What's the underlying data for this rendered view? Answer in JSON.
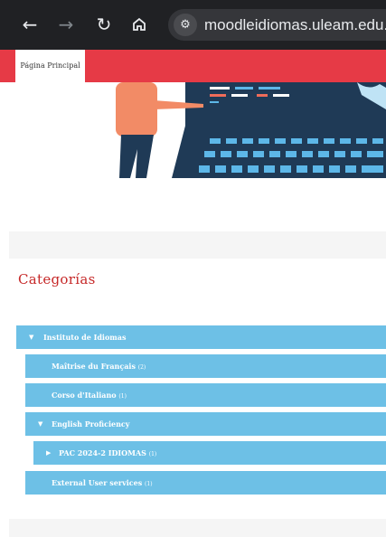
{
  "browser": {
    "back_icon": "arrow-left-icon",
    "forward_icon": "arrow-right-icon",
    "reload_icon": "reload-icon",
    "home_icon": "home-icon",
    "site_info_icon": "tune-icon",
    "url": "moodleidiomas.uleam.edu.ec"
  },
  "navbar": {
    "home_label": "Página Principal",
    "color": "#e63a46"
  },
  "page": {
    "categories_heading": "Categorías"
  },
  "categories": [
    {
      "name": "Instituto de Idiomas",
      "count": "",
      "expanded": true
    },
    {
      "name": "Maîtrise du Français",
      "count": "(2)"
    },
    {
      "name": "Corso d'Italiano",
      "count": "(1)"
    },
    {
      "name": "English Proficiency",
      "count": "",
      "expanded": true
    },
    {
      "name": "PAC 2024-2 IDIOMAS",
      "count": "(1)",
      "collapsed": true
    },
    {
      "name": "External User services",
      "count": "(1)"
    }
  ],
  "colors": {
    "accent": "#e63a46",
    "category_bg": "#6dc0e6",
    "heading": "#c62828"
  }
}
